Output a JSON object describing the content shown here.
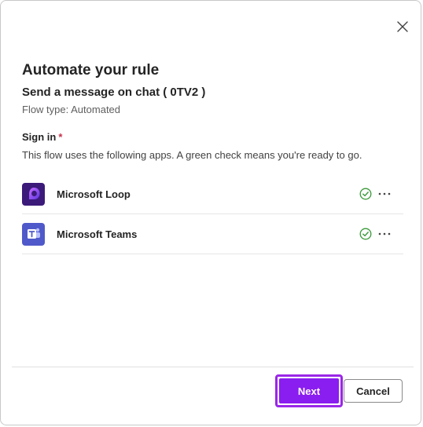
{
  "dialog": {
    "title": "Automate your rule",
    "subtitle": "Send a message on chat ( 0TV2 )",
    "flow_type": "Flow type: Automated",
    "signin_label": "Sign in",
    "required_marker": "*",
    "signin_description": "This flow uses the following apps. A green check means you're ready to go."
  },
  "apps": [
    {
      "name": "Microsoft Loop",
      "icon": "microsoft-loop-icon",
      "status": "connected",
      "status_icon": "check-circle-icon"
    },
    {
      "name": "Microsoft Teams",
      "icon": "microsoft-teams-icon",
      "status": "connected",
      "status_icon": "check-circle-icon"
    }
  ],
  "footer": {
    "next_label": "Next",
    "cancel_label": "Cancel"
  },
  "colors": {
    "accent": "#8a1df0",
    "focus_ring": "#9b27e8",
    "success": "#3a9a3a",
    "required": "#c4314b",
    "loop_bg": "#3b1a7a",
    "teams_bg": "#5059c9"
  }
}
